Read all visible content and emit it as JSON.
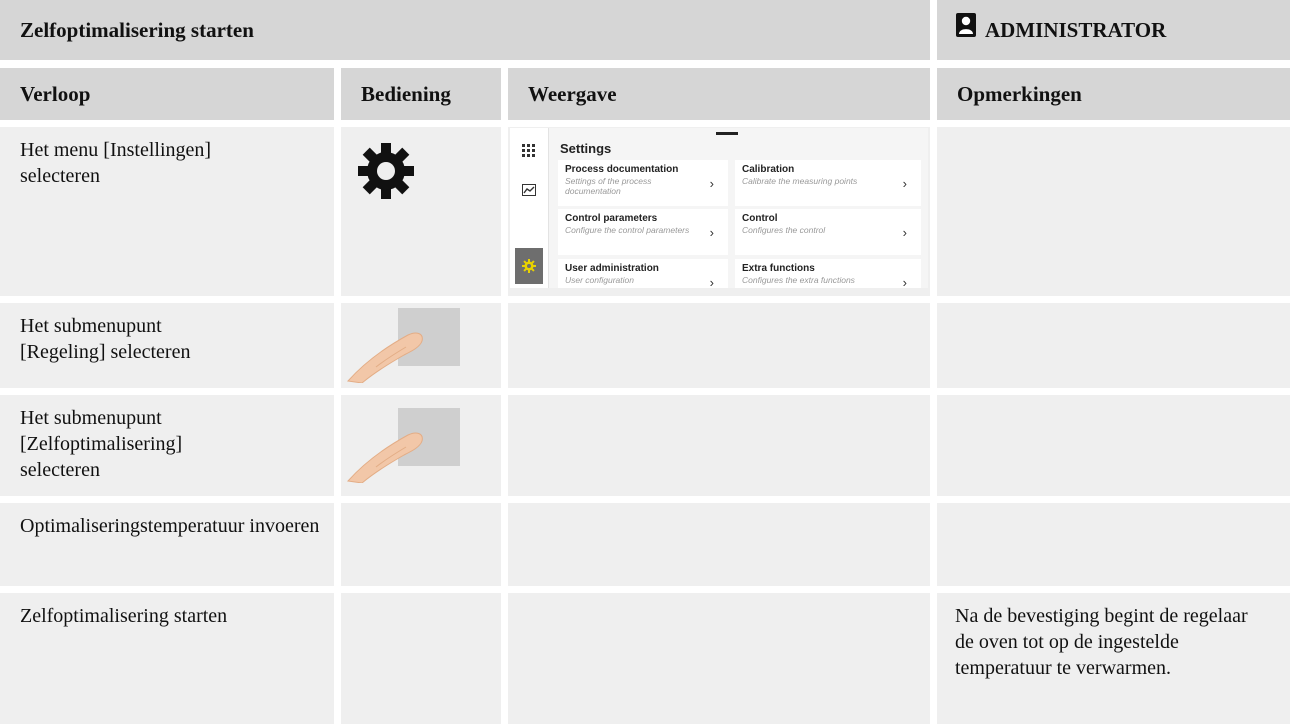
{
  "header": {
    "title": "Zelfoptimalisering starten",
    "role": "ADMINISTRATOR",
    "role_icon": "person-icon"
  },
  "columns": [
    "Verloop",
    "Bediening",
    "Weergave",
    "Opmerkingen"
  ],
  "rows": [
    {
      "verloop": "Het menu [Instellingen] selecteren",
      "bediening": "gear-icon",
      "opmerkingen": ""
    },
    {
      "verloop": "Het submenupunt [Regeling]  selecteren",
      "bediening": "finger-tap-icon",
      "opmerkingen": ""
    },
    {
      "verloop": "Het submenupunt [Zelfoptimalisering] selecteren",
      "bediening": "finger-tap-icon",
      "opmerkingen": ""
    },
    {
      "verloop": "Optimaliseringstemperatuur invoeren",
      "bediening": "",
      "opmerkingen": ""
    },
    {
      "verloop": "Zelfoptimalisering starten",
      "bediening": "",
      "opmerkingen": "Na de bevestiging begint de regelaar de oven tot op de ingestelde temperatuur te verwarmen."
    }
  ],
  "screenshot": {
    "title": "Settings",
    "cards": [
      {
        "title": "Process documentation",
        "subtitle": "Settings of the process documentation"
      },
      {
        "title": "Calibration",
        "subtitle": "Calibrate the measuring points"
      },
      {
        "title": "Control parameters",
        "subtitle": "Configure the control parameters"
      },
      {
        "title": "Control",
        "subtitle": "Configures the control"
      },
      {
        "title": "User administration",
        "subtitle": "User configuration"
      },
      {
        "title": "Extra functions",
        "subtitle": "Configures the extra functions"
      }
    ],
    "chevron": "›",
    "rail_icons": [
      "grid-icon",
      "chart-icon",
      "gear-icon"
    ],
    "accent": "#e8d200"
  }
}
